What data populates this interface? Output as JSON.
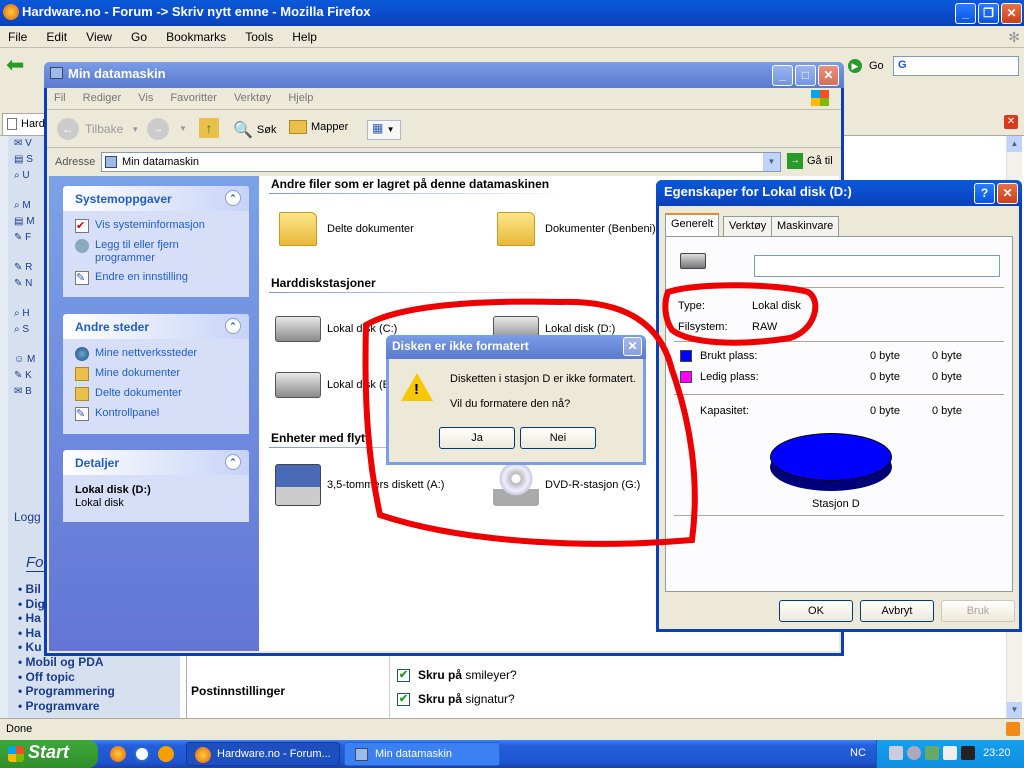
{
  "firefox": {
    "title": "Hardware.no - Forum -> Skriv nytt emne - Mozilla Firefox",
    "menu": [
      "File",
      "Edit",
      "View",
      "Go",
      "Bookmarks",
      "Tools",
      "Help"
    ],
    "go_label": "Go",
    "search_value": "G",
    "status": "Done",
    "tab_label": "Hard"
  },
  "forum": {
    "logg": "Logg",
    "fo": "Fo",
    "categories": [
      "• Bil",
      "• Dig",
      "• Ha",
      "• Ha",
      "• Ku",
      "• Mobil og PDA",
      "• Off topic",
      "• Programmering",
      "• Programvare"
    ],
    "post_settings": "Postinnstillinger",
    "checkbox_1_bold": "Skru på",
    "checkbox_1_rest": " smileyer?",
    "checkbox_2_bold": "Skru på",
    "checkbox_2_rest": " signatur?"
  },
  "explorer": {
    "title": "Min datamaskin",
    "menu": [
      "Fil",
      "Rediger",
      "Vis",
      "Favoritter",
      "Verktøy",
      "Hjelp"
    ],
    "back": "Tilbake",
    "search": "Søk",
    "folders": "Mapper",
    "address_label": "Adresse",
    "address_value": "Min datamaskin",
    "go": "Gå til",
    "panel_tasks": {
      "title": "Systemoppgaver",
      "items": [
        "Vis systeminformasjon",
        "Legg til eller fjern programmer",
        "Endre en innstilling"
      ]
    },
    "panel_places": {
      "title": "Andre steder",
      "items": [
        "Mine nettverkssteder",
        "Mine dokumenter",
        "Delte dokumenter",
        "Kontrollpanel"
      ]
    },
    "panel_details": {
      "title": "Detaljer",
      "name": "Lokal disk (D:)",
      "type": "Lokal disk"
    },
    "section_files": "Andre filer som er lagret på denne datamaskinen",
    "file_items": [
      "Delte dokumenter",
      "Dokumenter (Benbeni)"
    ],
    "section_drives": "Harddiskstasjoner",
    "drive_items": [
      "Lokal disk (C:)",
      "Lokal disk (D:)",
      "Lokal disk (E"
    ],
    "section_removable": "Enheter med flytt",
    "removable_items": [
      "3,5-tommers diskett (A:)",
      "DVD-R-stasjon (G:)"
    ]
  },
  "properties": {
    "title": "Egenskaper for Lokal disk (D:)",
    "tabs": [
      "Generelt",
      "Verktøy",
      "Maskinvare"
    ],
    "type_label": "Type:",
    "type_value": "Lokal disk",
    "fs_label": "Filsystem:",
    "fs_value": "RAW",
    "used_label": "Brukt plass:",
    "used_bytes": "0 byte",
    "used_short": "0 byte",
    "free_label": "Ledig plass:",
    "free_bytes": "0 byte",
    "free_short": "0 byte",
    "cap_label": "Kapasitet:",
    "cap_bytes": "0 byte",
    "cap_short": "0 byte",
    "drive_caption": "Stasjon D",
    "ok": "OK",
    "cancel": "Avbryt",
    "apply": "Bruk",
    "used_color": "#0000ff",
    "free_color": "#ff00ff"
  },
  "msgbox": {
    "title": "Disken er ikke formatert",
    "line1": "Disketten i stasjon D er ikke formatert.",
    "line2": "Vil du formatere den nå?",
    "yes": "Ja",
    "no": "Nei"
  },
  "taskbar": {
    "start": "Start",
    "tasks": [
      "Hardware.no - Forum...",
      "Min datamaskin"
    ],
    "lang": "NC",
    "clock": "23:20"
  }
}
